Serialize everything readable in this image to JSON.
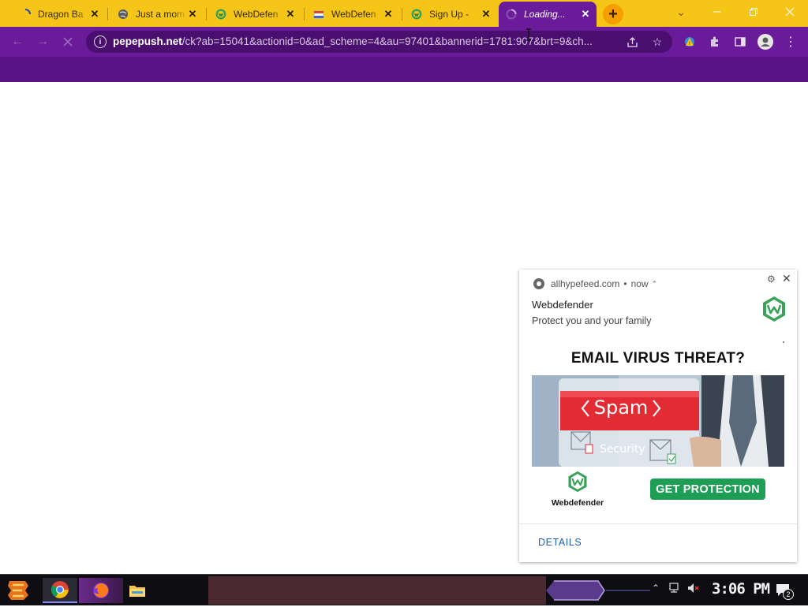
{
  "browser": {
    "tabs": [
      {
        "title": "Dragon Ba",
        "favicon": "loading-spinner-icon"
      },
      {
        "title": "Just a mom",
        "favicon": "globe-icon"
      },
      {
        "title": "WebDefen",
        "favicon": "webdefender-icon"
      },
      {
        "title": "WebDefen",
        "favicon": "webdefender-flag-icon"
      },
      {
        "title": "Sign Up -",
        "favicon": "webdefender-icon"
      },
      {
        "title": "Loading...",
        "favicon": "loading-spinner-icon",
        "active": true
      }
    ],
    "new_tab_label": "+",
    "address": {
      "host": "pepepush.net",
      "path": "/ck?ab=15041&actionid=0&ad_scheme=4&au=97401&bannerid=1781:907&brt=9&ch..."
    },
    "colors": {
      "tabstrip": "#f5c518",
      "toolbar": "#6a1b9a",
      "banner": "#5a1485"
    }
  },
  "notification": {
    "source": "allhypefeed.com",
    "time": "now",
    "title": "Webdefender",
    "body": "Protect you and your family",
    "ad": {
      "headline": "EMAIL VIRUS THREAT?",
      "spam_label": "Spam",
      "security_label": "Security",
      "brand_name": "Webdefender",
      "cta": "GET PROTECTION",
      "cta_color": "#1e9e55"
    },
    "details_label": "DETAILS"
  },
  "taskbar": {
    "apps": [
      "start-icon",
      "chrome-icon",
      "firefox-icon",
      "file-explorer-icon"
    ],
    "clock": "3:06 PM",
    "notification_count": "2"
  }
}
